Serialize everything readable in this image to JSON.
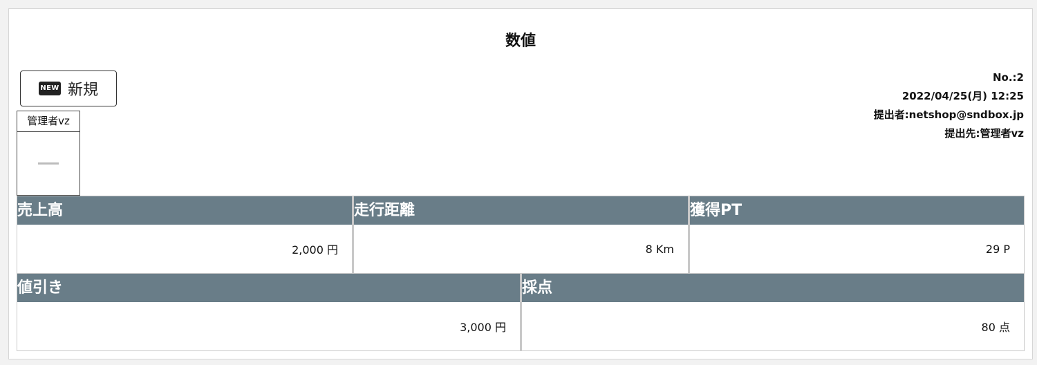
{
  "page": {
    "title": "数値"
  },
  "toolbar": {
    "new_icon_text": "NEW",
    "new_label": "新規"
  },
  "approver": {
    "name": "管理者vz",
    "stamp": "—"
  },
  "meta": {
    "number": "No.:2",
    "datetime": "2022/04/25(月) 12:25",
    "submitter": "提出者:netshop@sndbox.jp",
    "recipient": "提出先:管理者vz"
  },
  "fields": [
    {
      "label": "売上高",
      "value": "2,000 円"
    },
    {
      "label": "走行距離",
      "value": "8 Km"
    },
    {
      "label": "獲得PT",
      "value": "29 P"
    },
    {
      "label": "値引き",
      "value": "3,000 円"
    },
    {
      "label": "採点",
      "value": "80 点"
    }
  ],
  "colors": {
    "header_bg": "#697d88",
    "header_text": "#ffffff"
  }
}
